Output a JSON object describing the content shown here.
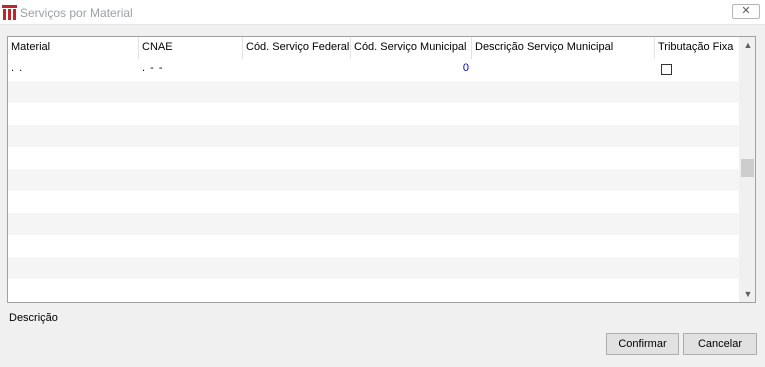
{
  "window": {
    "title": "Serviços por Material",
    "close_glyph": "✕",
    "icon": "app-logo-icon",
    "brand_color": "#c0272d"
  },
  "grid": {
    "columns": [
      "Material",
      "CNAE",
      "Cód. Serviço Federal",
      "Cód. Serviço Municipal",
      "Descrição Serviço Municipal",
      "Tributação Fixa"
    ],
    "rows": [
      {
        "material": ". .",
        "cnae": ". - -",
        "cod_federal": "",
        "cod_municipal": "0",
        "descricao": "",
        "tributacao_fixa": false
      }
    ],
    "row_stripe_color": "#f5f5f5"
  },
  "scrollbar": {
    "up_glyph": "▲",
    "down_glyph": "▼"
  },
  "footer": {
    "description_label": "Descrição",
    "confirm_label": "Confirmar",
    "cancel_label": "Cancelar"
  }
}
